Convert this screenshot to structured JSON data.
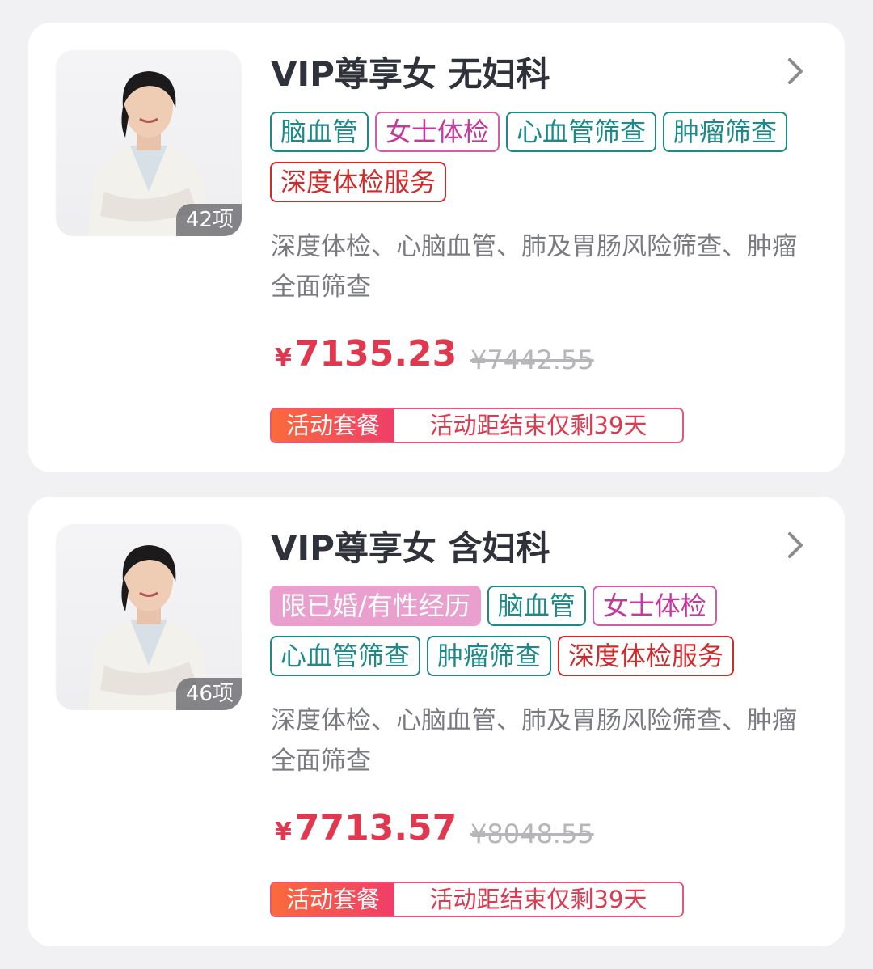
{
  "packages": [
    {
      "title": "VIP尊享女 无妇科",
      "item_count": "42项",
      "tags": [
        {
          "label": "脑血管",
          "style": "teal"
        },
        {
          "label": "女士体检",
          "style": "pink"
        },
        {
          "label": "心血管筛查",
          "style": "teal"
        },
        {
          "label": "肿瘤筛查",
          "style": "teal"
        },
        {
          "label": "深度体检服务",
          "style": "red"
        }
      ],
      "description": "深度体检、心脑血管、肺及胃肠风险筛查、肿瘤全面筛查",
      "currency": "¥",
      "price": "7135.23",
      "original_price": "¥7442.55",
      "promo_label": "活动套餐",
      "promo_text": "活动距结束仅剩39天"
    },
    {
      "title": "VIP尊享女 含妇科",
      "item_count": "46项",
      "tags": [
        {
          "label": "限已婚/有性经历",
          "style": "fill"
        },
        {
          "label": "脑血管",
          "style": "teal"
        },
        {
          "label": "女士体检",
          "style": "pink"
        },
        {
          "label": "心血管筛查",
          "style": "teal"
        },
        {
          "label": "肿瘤筛查",
          "style": "teal"
        },
        {
          "label": "深度体检服务",
          "style": "red"
        }
      ],
      "description": "深度体检、心脑血管、肺及胃肠风险筛查、肿瘤全面筛查",
      "currency": "¥",
      "price": "7713.57",
      "original_price": "¥8048.55",
      "promo_label": "活动套餐",
      "promo_text": "活动距结束仅剩39天"
    }
  ],
  "icons": {
    "chevron": "chevron-right-icon",
    "thumbnail": "woman-portrait-photo"
  },
  "colors": {
    "price": "#e0384f",
    "tag_teal": "#1d8a8a",
    "tag_pink": "#c8379b",
    "tag_red": "#d12a2a",
    "promo_gradient_start": "#fb6a3c",
    "promo_gradient_end": "#ef3e68"
  }
}
